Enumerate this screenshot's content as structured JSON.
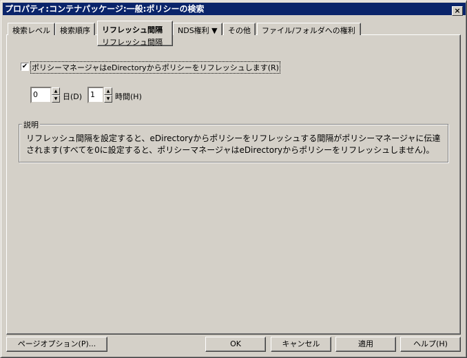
{
  "window": {
    "title": "プロパティ:コンテナパッケージ:一般:ポリシーの検索",
    "close_icon": "×"
  },
  "tabs": [
    {
      "label": "検索レベル"
    },
    {
      "label": "検索順序"
    },
    {
      "label": "リフレッシュ間隔",
      "sublabel": "リフレッシュ間隔",
      "active": true
    },
    {
      "label": "NDS権利 ▼"
    },
    {
      "label": "その他"
    },
    {
      "label": "ファイル/フォルダへの権利"
    }
  ],
  "refresh": {
    "checkbox_label": "ポリシーマネージャはeDirectoryからポリシーをリフレッシュします(R)",
    "checked": "✔",
    "days_value": "0",
    "days_label": "日(D)",
    "hours_value": "1",
    "hours_label": "時間(H)"
  },
  "description": {
    "title": "説明",
    "text": "リフレッシュ間隔を設定すると、eDirectoryからポリシーをリフレッシュする間隔がポリシーマネージャに伝達されます(すべてを0に設定すると、ポリシーマネージャはeDirectoryからポリシーをリフレッシュしません)。"
  },
  "buttons": {
    "page_options": "ページオプション(P)...",
    "ok": "OK",
    "cancel": "キャンセル",
    "apply": "適用",
    "help": "ヘルプ(H)"
  }
}
